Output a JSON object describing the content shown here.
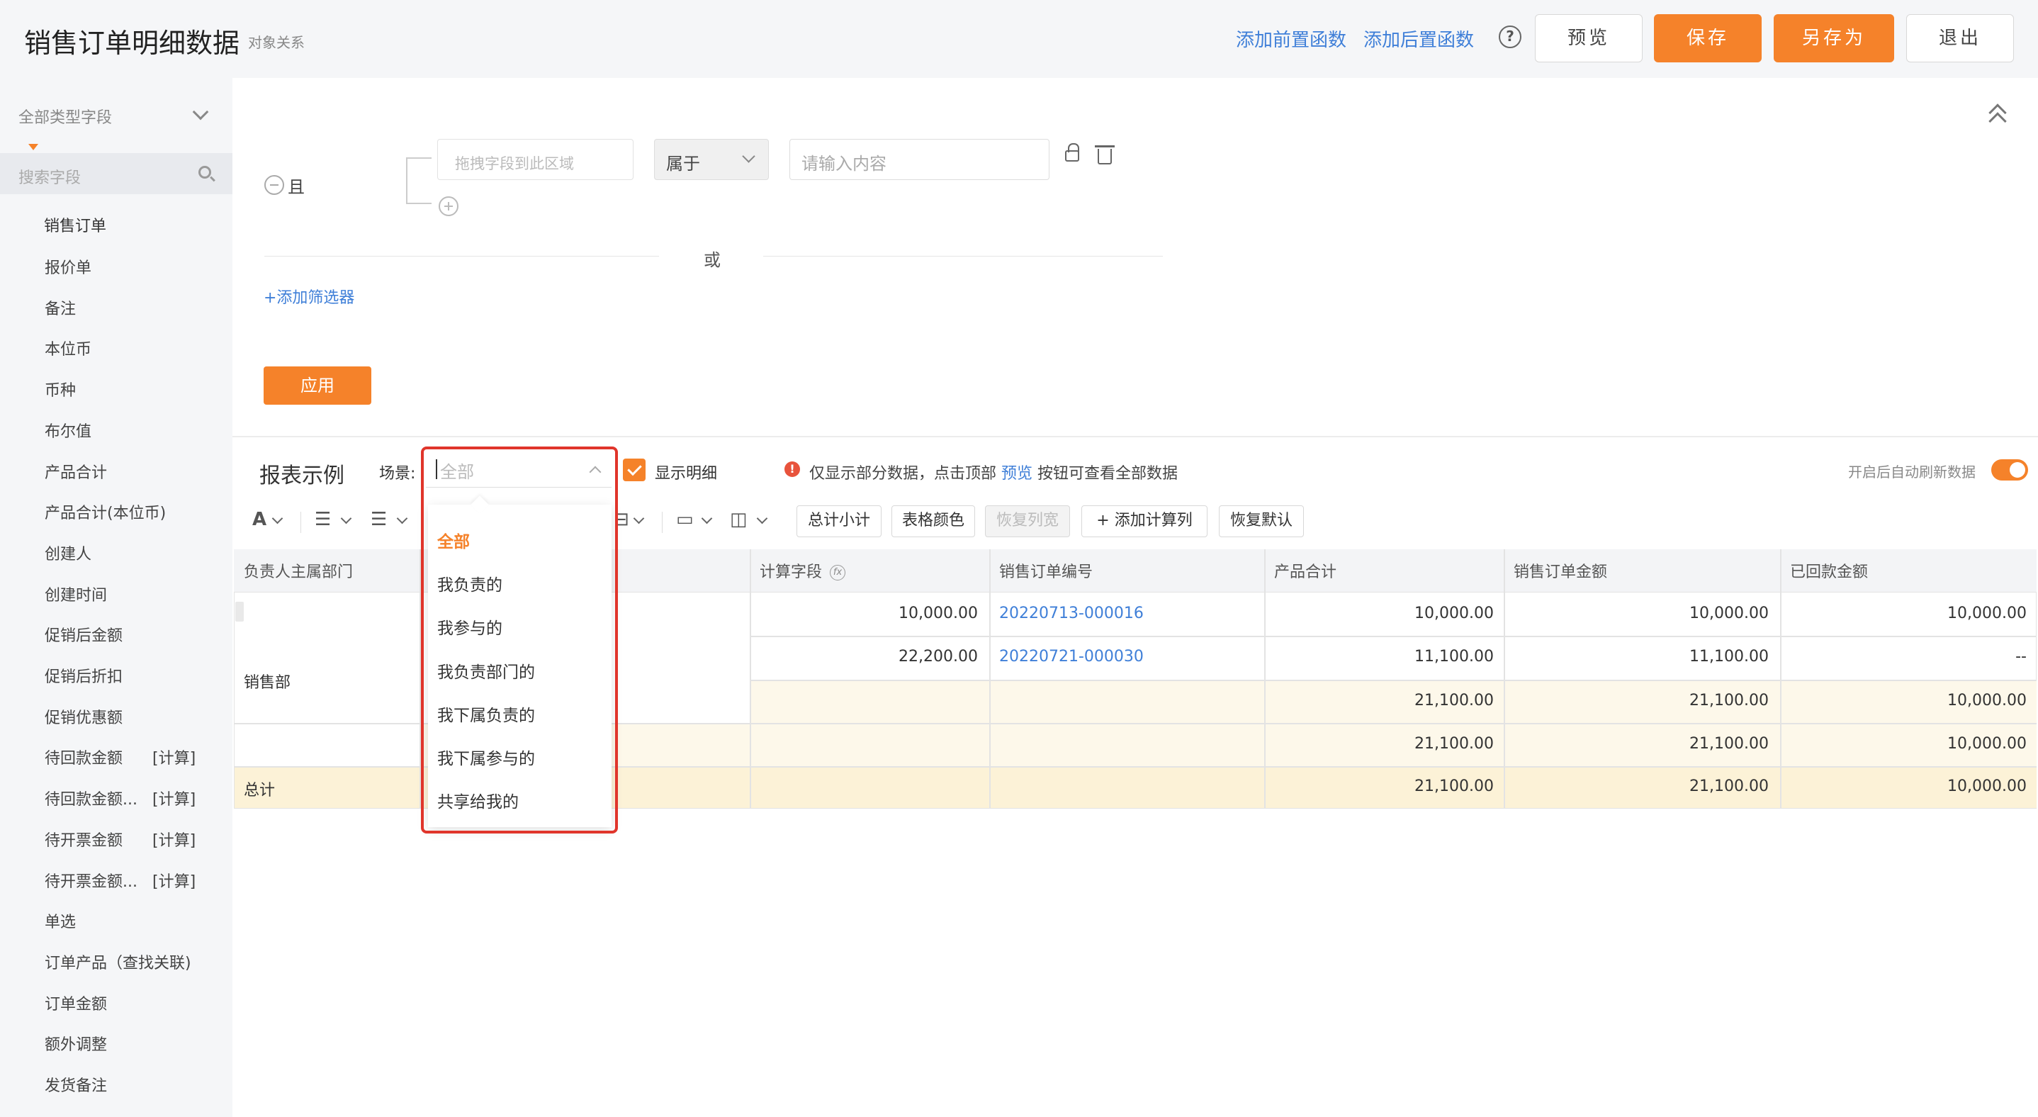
{
  "header": {
    "title": "销售订单明细数据",
    "subtitle": "对象关系",
    "link_pre_func": "添加前置函数",
    "link_post_func": "添加后置函数",
    "help_icon": "?",
    "btn_preview": "预览",
    "btn_save": "保存",
    "btn_save_as": "另存为",
    "btn_exit": "退出"
  },
  "sidebar": {
    "type_select": "全部类型字段",
    "search_placeholder": "搜索字段",
    "group": "销售订单",
    "items": [
      {
        "label": "报价单",
        "tag": ""
      },
      {
        "label": "备注",
        "tag": ""
      },
      {
        "label": "本位币",
        "tag": ""
      },
      {
        "label": "币种",
        "tag": ""
      },
      {
        "label": "布尔值",
        "tag": ""
      },
      {
        "label": "产品合计",
        "tag": ""
      },
      {
        "label": "产品合计(本位币)",
        "tag": ""
      },
      {
        "label": "创建人",
        "tag": ""
      },
      {
        "label": "创建时间",
        "tag": ""
      },
      {
        "label": "促销后金额",
        "tag": ""
      },
      {
        "label": "促销后折扣",
        "tag": ""
      },
      {
        "label": "促销优惠额",
        "tag": ""
      },
      {
        "label": "待回款金额",
        "tag": "[计算]"
      },
      {
        "label": "待回款金额...",
        "tag": "[计算]"
      },
      {
        "label": "待开票金额",
        "tag": "[计算]"
      },
      {
        "label": "待开票金额...",
        "tag": "[计算]"
      },
      {
        "label": "单选",
        "tag": ""
      },
      {
        "label": "订单产品（查找关联)",
        "tag": ""
      },
      {
        "label": "订单金额",
        "tag": ""
      },
      {
        "label": "额外调整",
        "tag": ""
      },
      {
        "label": "发货备注",
        "tag": ""
      }
    ]
  },
  "filter": {
    "and_label": "且",
    "drop_field_placeholder": "拖拽字段到此区域",
    "operator": "属于",
    "value_placeholder": "请输入内容",
    "or_label": "或",
    "add_filter": "+添加筛选器",
    "apply": "应用"
  },
  "report": {
    "title": "报表示例",
    "scene_label": "场景:",
    "scene_placeholder": "全部",
    "show_detail": "显示明细",
    "notice_prefix": "仅显示部分数据，点击顶部",
    "notice_link": "预览",
    "notice_suffix": "按钮可查看全部数据",
    "auto_refresh": "开启后自动刷新数据"
  },
  "toolbar": {
    "font_icon": "A",
    "btn_subtotal": "总计小计",
    "btn_table_color": "表格颜色",
    "btn_restore_width": "恢复列宽",
    "btn_add_calc": "添加计算列",
    "btn_restore_default": "恢复默认",
    "add_icon": "+"
  },
  "table": {
    "headers": [
      "负责人主属部门",
      "计算字段",
      "销售订单编号",
      "产品合计",
      "销售订单金额",
      "已回款金额"
    ],
    "fx_label": "fx",
    "dept": "销售部",
    "total_label": "总计",
    "rows": [
      {
        "calc": "10,000.00",
        "order_no": "20220713-000016",
        "product_total": "10,000.00",
        "order_amount": "10,000.00",
        "paid": "10,000.00"
      },
      {
        "calc": "22,200.00",
        "order_no": "20220721-000030",
        "product_total": "11,100.00",
        "order_amount": "11,100.00",
        "paid": "--"
      }
    ],
    "subtotal_1": {
      "product_total": "21,100.00",
      "order_amount": "21,100.00",
      "paid": "10,000.00"
    },
    "subtotal_2": {
      "product_total": "21,100.00",
      "order_amount": "21,100.00",
      "paid": "10,000.00"
    },
    "grand_total": {
      "product_total": "21,100.00",
      "order_amount": "21,100.00",
      "paid": "10,000.00"
    }
  },
  "scene_dropdown": {
    "options": [
      "全部",
      "我负责的",
      "我参与的",
      "我负责部门的",
      "我下属负责的",
      "我下属参与的",
      "共享给我的"
    ],
    "selected": "全部"
  },
  "colors": {
    "accent": "#f5822a",
    "link": "#3f7fd8",
    "highlight": "#e0352b"
  }
}
